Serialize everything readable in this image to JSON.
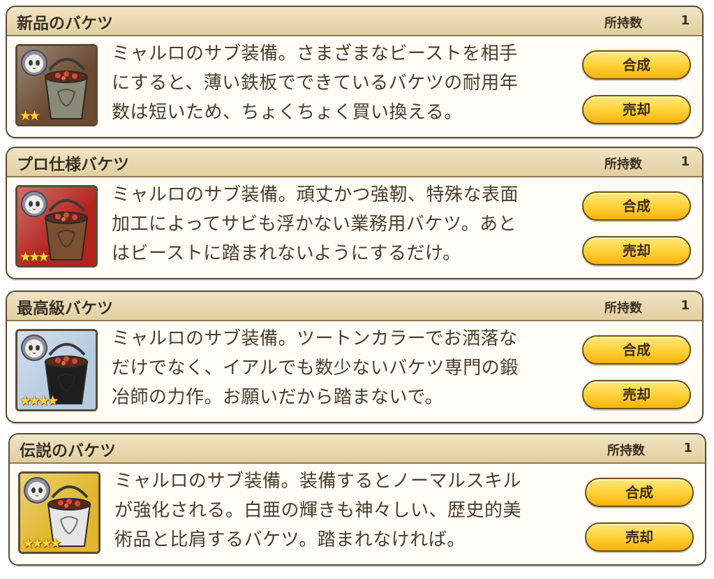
{
  "count_label": "所持数",
  "buttons": {
    "synthesize": "合成",
    "sell": "売却"
  },
  "items": [
    {
      "name": "新品のバケツ",
      "count": "1",
      "description": "ミャルロのサブ装備。さまざまなビーストを相手\nにすると、薄い鉄板でできているバケツの耐用年\n数は短いため、ちょくちょく買い換える。",
      "stars": "★★",
      "rarity": 2,
      "icon": "bucket-icon",
      "icon_bg": "#6b4a32",
      "bucket_color": "#8a8a78"
    },
    {
      "name": "プロ仕様バケツ",
      "count": "1",
      "description": "ミャルロのサブ装備。頑丈かつ強靭、特殊な表面\n加工によってサビも浮かない業務用バケツ。あと\nはビーストに踏まれないようにするだけ。",
      "stars": "★★★",
      "rarity": 3,
      "icon": "bucket-icon",
      "icon_bg": "#b3241b",
      "bucket_color": "#7a5030"
    },
    {
      "name": "最高級バケツ",
      "count": "1",
      "description": "ミャルロのサブ装備。ツートンカラーでお洒落な\nだけでなく、イアルでも数少ないバケツ専門の鍛\n冶師の力作。お願いだから踏まないで。",
      "stars": "★★★★",
      "rarity": 4,
      "icon": "bucket-icon",
      "icon_bg": "#b8cce0",
      "bucket_color": "#1e1e1e"
    },
    {
      "name": "伝説のバケツ",
      "count": "1",
      "description": "ミャルロのサブ装備。装備するとノーマルスキル\nが強化される。白亜の輝きも神々しい、歴史的美\n術品と比肩するバケツ。踏まれなければ。",
      "stars": "★★★★",
      "rarity": 4,
      "icon": "bucket-icon",
      "icon_bg": "#e0b72c",
      "bucket_color": "#e6e6e6"
    }
  ]
}
